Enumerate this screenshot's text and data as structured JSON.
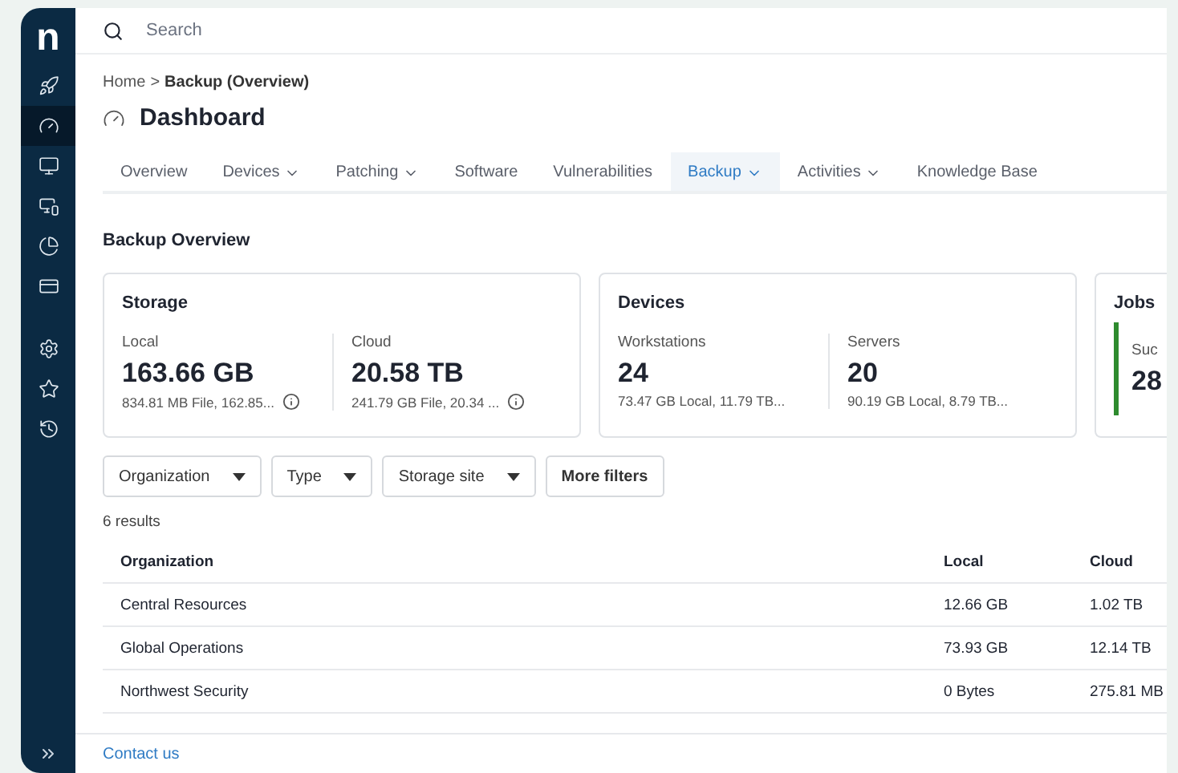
{
  "sidebar": {
    "logo": "n",
    "items": [
      {
        "kind": "rocket",
        "selected": false
      },
      {
        "kind": "gauge",
        "selected": true
      },
      {
        "kind": "monitor",
        "selected": false
      },
      {
        "kind": "screens",
        "selected": false
      },
      {
        "kind": "pie",
        "selected": false
      },
      {
        "kind": "card",
        "selected": false
      },
      {
        "kind": "gear",
        "selected": false
      },
      {
        "kind": "star",
        "selected": false
      },
      {
        "kind": "history",
        "selected": false
      }
    ]
  },
  "search": {
    "placeholder": "Search"
  },
  "breadcrumb": {
    "home": "Home",
    "separator": ">",
    "current": "Backup (Overview)"
  },
  "page_title": "Dashboard",
  "tabs": [
    {
      "label": "Overview",
      "dropdown": false,
      "selected": false
    },
    {
      "label": "Devices",
      "dropdown": true,
      "selected": false
    },
    {
      "label": "Patching",
      "dropdown": true,
      "selected": false
    },
    {
      "label": "Software",
      "dropdown": false,
      "selected": false
    },
    {
      "label": "Vulnerabilities",
      "dropdown": false,
      "selected": false
    },
    {
      "label": "Backup",
      "dropdown": true,
      "selected": true
    },
    {
      "label": "Activities",
      "dropdown": true,
      "selected": false
    },
    {
      "label": "Knowledge Base",
      "dropdown": false,
      "selected": false
    }
  ],
  "section_title": "Backup Overview",
  "cards": [
    {
      "title": "Storage",
      "stats": [
        {
          "label": "Local",
          "value": "163.66 GB",
          "detail": "834.81 MB File, 162.85...",
          "info": true
        },
        {
          "label": "Cloud",
          "value": "20.58 TB",
          "detail": "241.79 GB File, 20.34 ...",
          "info": true
        }
      ]
    },
    {
      "title": "Devices",
      "stats": [
        {
          "label": "Workstations",
          "value": "24",
          "detail": "73.47 GB Local, 11.79 TB...",
          "info": false
        },
        {
          "label": "Servers",
          "value": "20",
          "detail": "90.19 GB Local, 8.79 TB...",
          "info": false
        }
      ]
    }
  ],
  "jobs_card": {
    "title": "Jobs",
    "stat_label": "Suc",
    "stat_value": "28",
    "color": "#2e8b2e"
  },
  "filters": [
    {
      "label": "Organization",
      "dropdown": true
    },
    {
      "label": "Type",
      "dropdown": true
    },
    {
      "label": "Storage site",
      "dropdown": true
    },
    {
      "label": "More filters",
      "dropdown": false
    }
  ],
  "results": "6 results",
  "table": {
    "columns": [
      "Organization",
      "Local",
      "Cloud"
    ],
    "rows": [
      [
        "Central Resources",
        "12.66 GB",
        "1.02 TB"
      ],
      [
        "Global Operations",
        "73.93 GB",
        "12.14 TB"
      ],
      [
        "Northwest Security",
        "0 Bytes",
        "275.81 MB"
      ]
    ]
  },
  "footer_link": "Contact us"
}
